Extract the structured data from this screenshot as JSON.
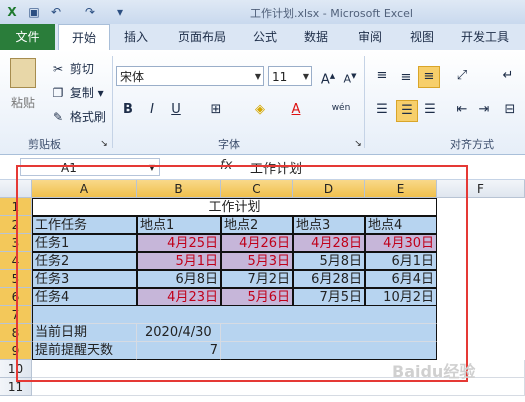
{
  "titlebar": {
    "doc_title": "工作计划.xlsx - Microsoft Excel"
  },
  "ribbon_tabs": [
    "文件",
    "开始",
    "插入",
    "页面布局",
    "公式",
    "数据",
    "审阅",
    "视图",
    "开发工具"
  ],
  "clipboard": {
    "paste": "粘贴",
    "cut": "剪切",
    "copy": "复制",
    "format_painter": "格式刷",
    "group": "剪贴板"
  },
  "font": {
    "name": "宋体",
    "size": "11",
    "group": "字体",
    "bold": "B",
    "italic": "I",
    "underline": "U",
    "wen": "wén"
  },
  "alignment": {
    "group": "对齐方式"
  },
  "formula_bar": {
    "name_box": "A1",
    "fx": "fx",
    "content": "工作计划"
  },
  "columns": [
    "A",
    "B",
    "C",
    "D",
    "E",
    "F"
  ],
  "rows": [
    "1",
    "2",
    "3",
    "4",
    "5",
    "6",
    "7",
    "8",
    "9",
    "10",
    "11"
  ],
  "sheet": {
    "title": "工作计划",
    "headers": [
      "工作任务",
      "地点1",
      "地点2",
      "地点3",
      "地点4"
    ],
    "tasks": [
      {
        "name": "任务1",
        "v": [
          "4月25日",
          "4月26日",
          "4月28日",
          "4月30日"
        ]
      },
      {
        "name": "任务2",
        "v": [
          "5月1日",
          "5月3日",
          "5月8日",
          "6月1日"
        ]
      },
      {
        "name": "任务3",
        "v": [
          "6月8日",
          "7月2日",
          "6月28日",
          "6月4日"
        ]
      },
      {
        "name": "任务4",
        "v": [
          "4月23日",
          "5月6日",
          "7月5日",
          "10月2日"
        ]
      }
    ],
    "current_date_label": "当前日期",
    "current_date": "2020/4/30",
    "reminder_label": "提前提醒天数",
    "reminder_days": "7"
  },
  "colors": {
    "accent": "#2a7d3a",
    "highlight_blue": "#b7d4f0",
    "highlight_purple": "#c6b6d9",
    "due_red": "#c0001a",
    "frame": "#e53935"
  },
  "watermark": "Baidu经验"
}
